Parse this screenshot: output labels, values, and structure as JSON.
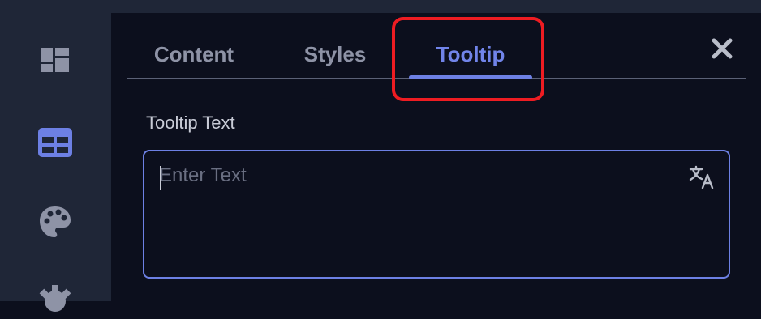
{
  "tabs": [
    {
      "label": "Content",
      "active": false
    },
    {
      "label": "Styles",
      "active": false
    },
    {
      "label": "Tooltip",
      "active": true
    }
  ],
  "sidebar": {
    "items": [
      {
        "icon": "dashboard-icon",
        "active": false
      },
      {
        "icon": "table-icon",
        "active": true
      },
      {
        "icon": "palette-icon",
        "active": false
      },
      {
        "icon": "gear-icon",
        "active": false
      }
    ]
  },
  "tooltip_field": {
    "label": "Tooltip Text",
    "placeholder": "Enter Text",
    "value": ""
  },
  "icons": {
    "close": "close-icon",
    "translate": "translate-icon"
  },
  "colors": {
    "accent": "#6d80e4",
    "highlight": "#ee1c22",
    "sidebar_bg": "#1f2637",
    "panel_bg": "#0c0f1d",
    "icon_muted": "#8e93a6"
  }
}
